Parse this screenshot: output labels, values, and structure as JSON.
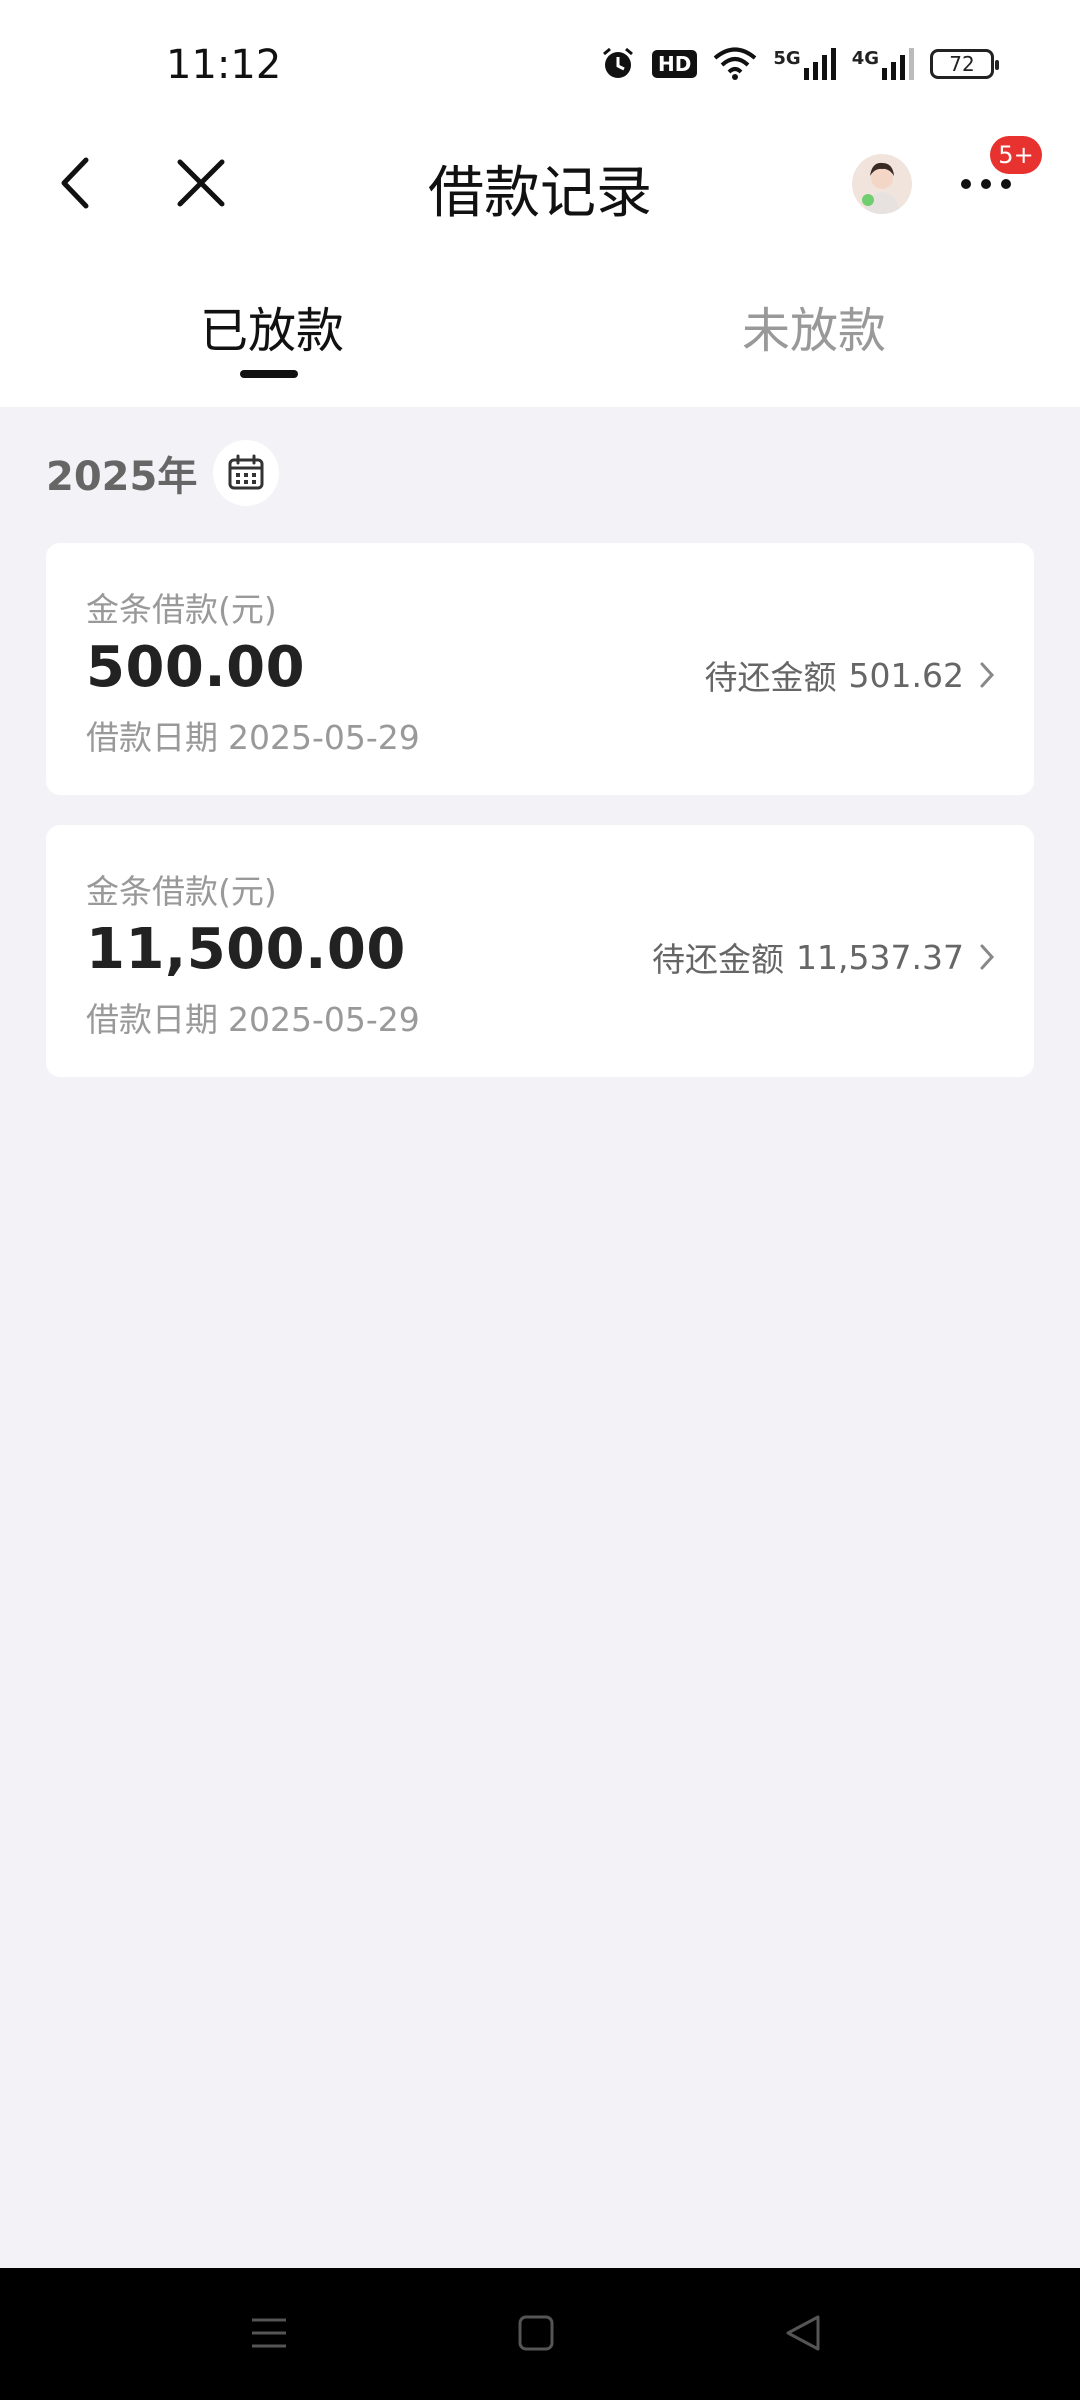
{
  "status_bar": {
    "time": "11:12",
    "hd_label": "HD",
    "signal1_label": "5G",
    "signal2_label": "4G",
    "battery": "72"
  },
  "navbar": {
    "title": "借款记录",
    "badge": "5+"
  },
  "tabs": [
    {
      "label": "已放款",
      "active": true
    },
    {
      "label": "未放款",
      "active": false
    }
  ],
  "year_label": "2025年",
  "loans": [
    {
      "label": "金条借款(元)",
      "amount": "500.00",
      "date_label": "借款日期",
      "date": "2025-05-29",
      "due_label": "待还金额",
      "due_amount": "501.62"
    },
    {
      "label": "金条借款(元)",
      "amount": "11,500.00",
      "date_label": "借款日期",
      "date": "2025-05-29",
      "due_label": "待还金额",
      "due_amount": "11,537.37"
    }
  ],
  "colors": {
    "background": "#f2f2f7",
    "badge": "#e8322f",
    "primary_text": "#222222",
    "secondary_text": "#999999"
  },
  "icons": [
    "alarm-icon",
    "wifi-icon",
    "back-icon",
    "close-icon",
    "more-icon",
    "calendar-icon",
    "chevron-right-icon",
    "menu-icon",
    "home-icon",
    "back-triangle-icon"
  ]
}
